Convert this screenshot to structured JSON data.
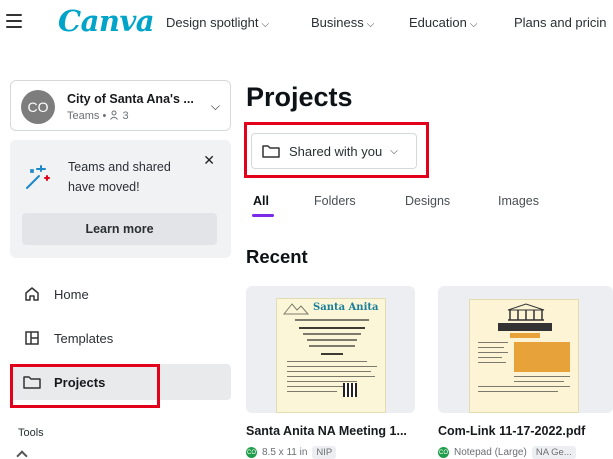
{
  "nav": {
    "logo": "Canva",
    "links": [
      "Design spotlight",
      "Business",
      "Education",
      "Plans and pricin"
    ]
  },
  "sidebar": {
    "team": {
      "initials": "CO",
      "name": "City of Santa Ana's ...",
      "sub": "Teams • ",
      "members": "3"
    },
    "notice": {
      "text": "Teams and shared have moved!",
      "button": "Learn more"
    },
    "items": [
      {
        "label": "Home",
        "icon": "home-icon"
      },
      {
        "label": "Templates",
        "icon": "templates-icon"
      },
      {
        "label": "Projects",
        "icon": "folder-icon"
      }
    ],
    "tools_label": "Tools"
  },
  "main": {
    "title": "Projects",
    "filter_label": "Shared with you",
    "tabs": [
      "All",
      "Folders",
      "Designs",
      "Images"
    ],
    "section_title": "Recent",
    "cards": [
      {
        "title": "Santa Anita NA Meeting 1...",
        "size": "8.5 x 11 in",
        "badge": "NIP",
        "thumb_heading": "Santa Anita"
      },
      {
        "title": "Com-Link 11-17-2022.pdf",
        "size": "Notepad (Large)",
        "badge": "NA Ge..."
      }
    ]
  },
  "colors": {
    "brand": "#00a4c9",
    "accent": "#7d2ae8",
    "highlight": "#e3001b"
  }
}
